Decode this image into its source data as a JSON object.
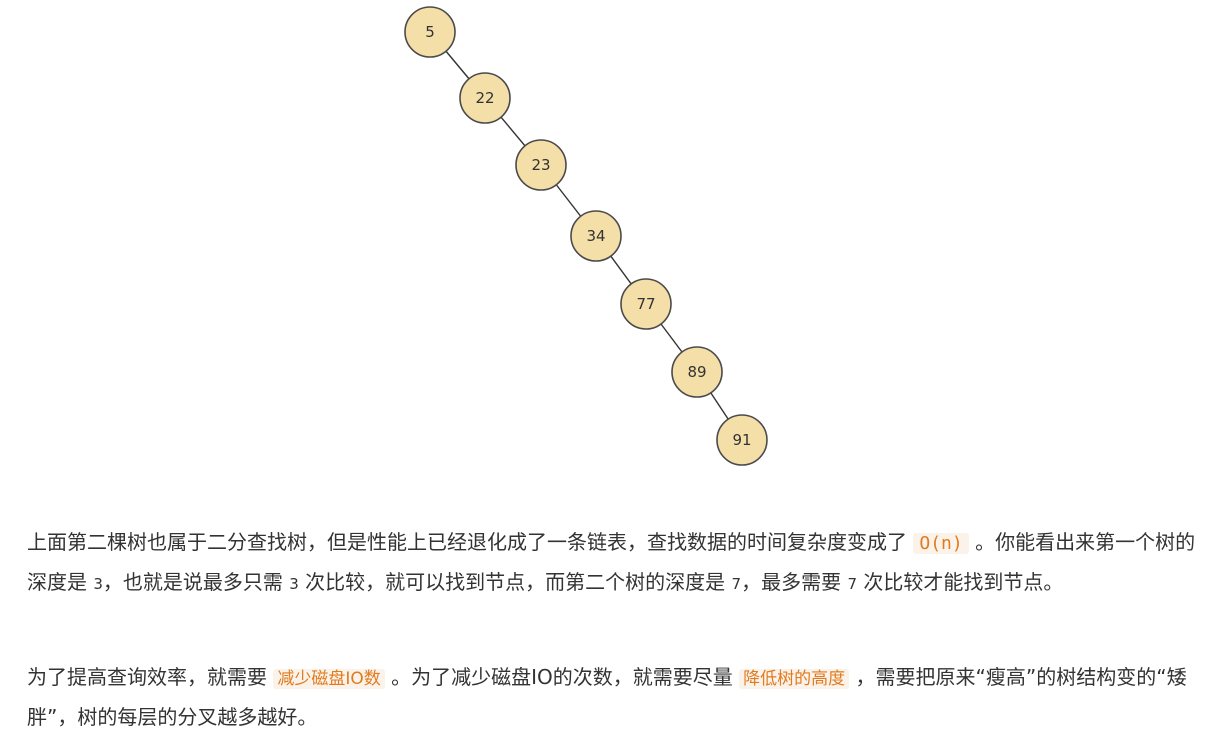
{
  "tree": {
    "nodes": [
      "5",
      "22",
      "23",
      "34",
      "77",
      "89",
      "91"
    ]
  },
  "paragraph1": {
    "seg1": "上面第二棵树也属于二分查找树，但是性能上已经退化成了一条链表，查找数据的时间复杂度变成了",
    "code": "O(n)",
    "seg2": "。你能看出来第一个树的深度是",
    "depth1": "3",
    "seg3": "，也就是说最多只需",
    "compare1": "3",
    "seg4": "次比较，就可以找到节点，而第二个树的深度是",
    "depth2": "7",
    "seg5": "，最多需要",
    "compare2": "7",
    "seg6": "次比较才能找到节点。"
  },
  "paragraph2": {
    "seg1": "为了提高查询效率，就需要",
    "highlight1": "减少磁盘IO数",
    "seg2": "。为了减少磁盘IO的次数，就需要尽量",
    "highlight2": "降低树的高度",
    "seg3": "，需要把原来“瘦高”的树结构变的“矮胖”，树的每层的分叉越多越好。"
  }
}
